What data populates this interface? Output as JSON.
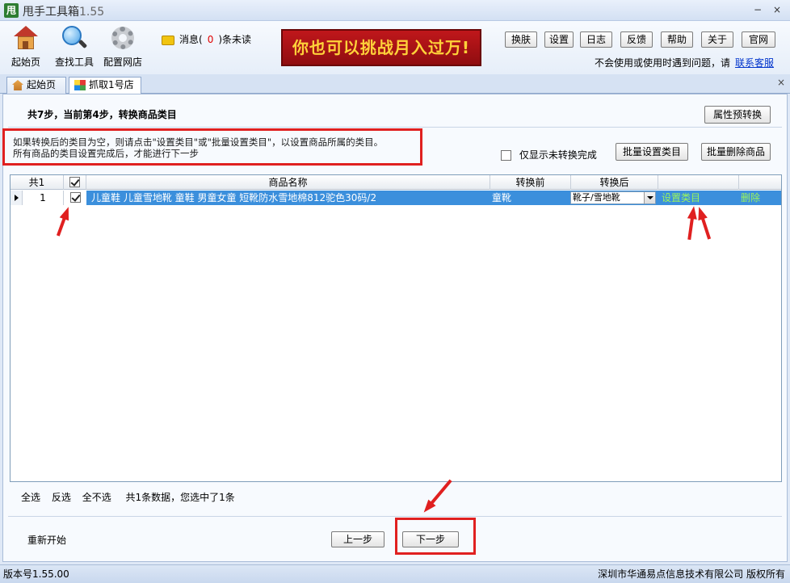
{
  "window": {
    "icon_glyph": "甩",
    "title": "甩手工具箱",
    "version": "1.55",
    "minimize": "−",
    "close": "×"
  },
  "toolbar": {
    "items": [
      {
        "label": "起始页",
        "icon": "home-icon"
      },
      {
        "label": "查找工具",
        "icon": "magnifier-icon"
      },
      {
        "label": "配置网店",
        "icon": "gear-icon"
      }
    ],
    "message_prefix": "消息(",
    "message_count": "0",
    "message_suffix": ")条未读",
    "banner": "你也可以挑战月入过万!",
    "buttons": [
      "换肤",
      "设置",
      "日志",
      "反馈",
      "帮助",
      "关于",
      "官网"
    ],
    "help_text": "不会使用或使用时遇到问题，请",
    "help_link": "联系客服"
  },
  "tabs": [
    {
      "label": "起始页",
      "active": false
    },
    {
      "label": "抓取1号店",
      "active": true
    }
  ],
  "tab_close": "×",
  "step": {
    "title": "共7步，当前第4步，转换商品类目",
    "attr_convert_btn": "属性预转换"
  },
  "notice": {
    "line1": "如果转换后的类目为空，则请点击\"设置类目\"或\"批量设置类目\"，以设置商品所属的类目。",
    "line2": "所有商品的类目设置完成后，才能进行下一步"
  },
  "filter": {
    "only_unconverted_label": "仅显示未转换完成",
    "batch_set_btn": "批量设置类目",
    "batch_delete_btn": "批量删除商品"
  },
  "grid": {
    "headers": {
      "count": "共1",
      "name": "商品名称",
      "before": "转换前",
      "after": "转换后"
    },
    "rows": [
      {
        "index": "1",
        "checked": true,
        "name": "儿童鞋 儿童雪地靴 童鞋 男童女童 短靴防水雪地棉812驼色30码/2",
        "before": "童靴",
        "after": "靴子/雪地靴",
        "set_category": "设置类目",
        "delete": "删除"
      }
    ]
  },
  "selection": {
    "select_all": "全选",
    "invert": "反选",
    "select_none": "全不选",
    "summary": "共1条数据，您选中了1条"
  },
  "nav": {
    "restart": "重新开始",
    "prev": "上一步",
    "next": "下一步"
  },
  "status": {
    "version": "版本号1.55.00",
    "copyright": "深圳市华通易点信息技术有限公司 版权所有"
  },
  "colors": {
    "accent_red": "#e02020",
    "selection_blue": "#3b8fdc",
    "link_green": "#9cf55a",
    "banner_red": "#c0171b",
    "banner_text": "#ffd23a"
  }
}
